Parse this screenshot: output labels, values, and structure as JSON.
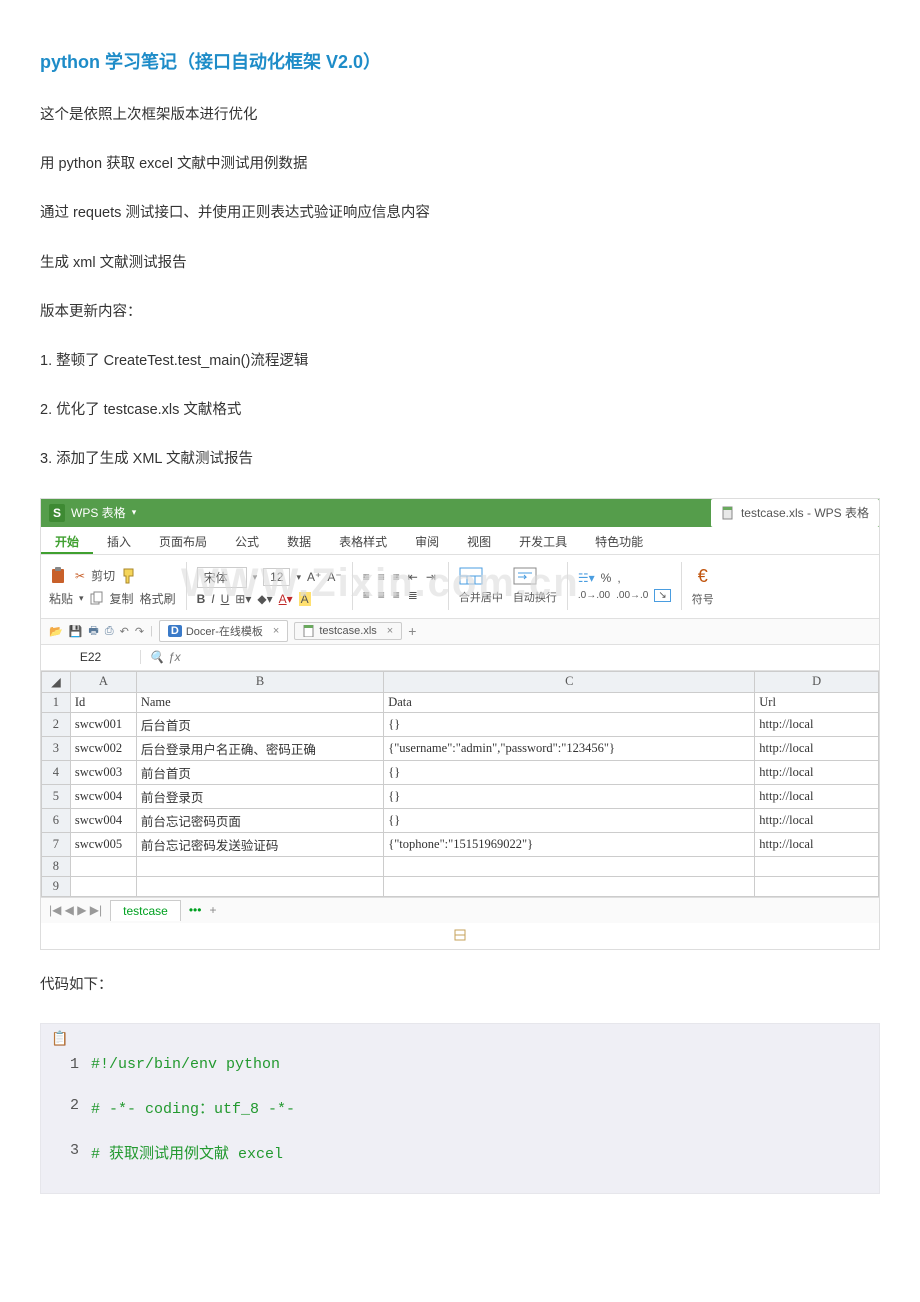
{
  "title": "python 学习笔记（接口自动化框架  V2.0）",
  "paras": {
    "p1": "这个是依照上次框架版本进行优化",
    "p2": "用 python 获取 excel 文献中测试用例数据",
    "p3": "通过 requets 测试接口、并使用正则表达式验证响应信息内容",
    "p4": "生成 xml 文献测试报告",
    "p5": "版本更新内容：",
    "p6": "1.  整顿了 CreateTest.test_main()流程逻辑",
    "p7": "2.  优化了 testcase.xls 文献格式",
    "p8": "3.  添加了生成 XML 文献测试报告"
  },
  "wps": {
    "app_label": "WPS 表格",
    "title_right": "testcase.xls - WPS 表格",
    "tabs": [
      "开始",
      "插入",
      "页面布局",
      "公式",
      "数据",
      "表格样式",
      "审阅",
      "视图",
      "开发工具",
      "特色功能"
    ],
    "ribbon": {
      "cut": "剪切",
      "paste": "粘贴",
      "copy": "复制",
      "fmtpaint": "格式刷",
      "font": "宋体",
      "fontsize": "12",
      "merge": "合并居中",
      "wrap": "自动换行",
      "percent": "%",
      "fuhao": "符号"
    },
    "quick": {
      "docer": "Docer-在线模板",
      "file": "testcase.xls"
    },
    "namebox": "E22",
    "columns": [
      "A",
      "B",
      "C",
      "D"
    ],
    "header": {
      "A": "Id",
      "B": "Name",
      "C": "Data",
      "D": "Url"
    },
    "rows": [
      {
        "A": "swcw001",
        "B": "后台首页",
        "C": "{}",
        "D": "http://local"
      },
      {
        "A": "swcw002",
        "B": "后台登录用户名正确、密码正确",
        "C": "{\"username\":\"admin\",\"password\":\"123456\"}",
        "D": "http://local"
      },
      {
        "A": "swcw003",
        "B": "前台首页",
        "C": "{}",
        "D": "http://local"
      },
      {
        "A": "swcw004",
        "B": "前台登录页",
        "C": "{}",
        "D": "http://local"
      },
      {
        "A": "swcw004",
        "B": "前台忘记密码页面",
        "C": "{}",
        "D": "http://local"
      },
      {
        "A": "swcw005",
        "B": "前台忘记密码发送验证码",
        "C": "{\"tophone\":\"15151969022\"}",
        "D": "http://local"
      }
    ],
    "sheettab": "testcase"
  },
  "code_label": "代码如下：",
  "code": {
    "l1": "#!/usr/bin/env python",
    "l2": "# -*- coding：utf_8 -*-",
    "l3": "#  获取测试用例文献 excel"
  }
}
